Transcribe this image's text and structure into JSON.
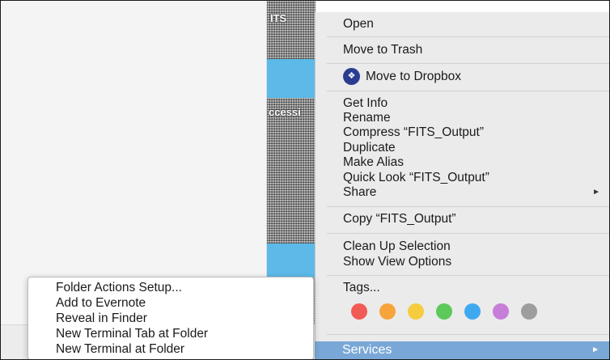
{
  "background": {
    "file_label_1": "ITS",
    "file_label_2": "ccessi"
  },
  "context_menu": {
    "open": "Open",
    "move_to_trash": "Move to Trash",
    "move_to_dropbox": "Move to Dropbox",
    "get_info": "Get Info",
    "rename": "Rename",
    "compress": "Compress “FITS_Output”",
    "duplicate": "Duplicate",
    "make_alias": "Make Alias",
    "quick_look": "Quick Look “FITS_Output”",
    "share": "Share",
    "copy": "Copy “FITS_Output”",
    "clean_up_selection": "Clean Up Selection",
    "show_view_options": "Show View Options",
    "tags": "Tags...",
    "services": "Services",
    "submenu_arrow": "►",
    "tag_colors": [
      "#f25a55",
      "#f7a43c",
      "#f5cc3e",
      "#5dc95a",
      "#3fa9f0",
      "#c77ed8",
      "#9d9d9d"
    ]
  },
  "services_submenu": {
    "items": [
      "Folder Actions Setup...",
      "Add to Evernote",
      "Reveal in Finder",
      "New Terminal Tab at Folder",
      "New Terminal at Folder"
    ]
  }
}
